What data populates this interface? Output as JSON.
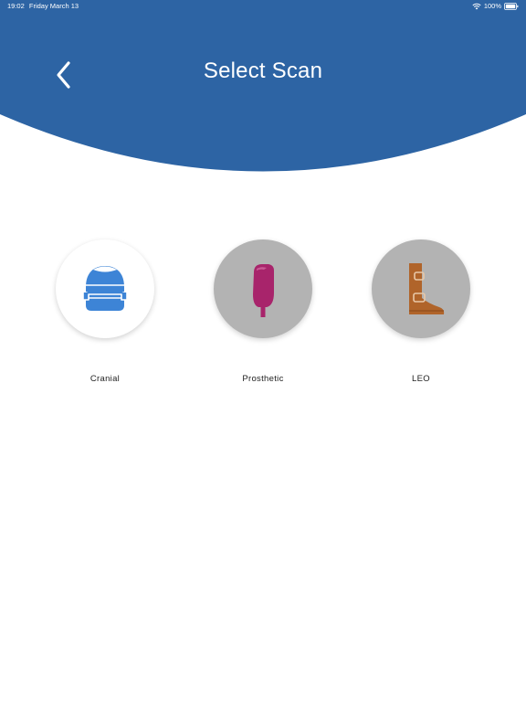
{
  "status_bar": {
    "time": "19:02",
    "date": "Friday March 13",
    "battery": "100%"
  },
  "header": {
    "title": "Select Scan",
    "back_icon": "chevron-left-icon",
    "color": "#2d64a4"
  },
  "options": [
    {
      "label": "Cranial",
      "icon": "helmet-icon",
      "selected": true,
      "circle_color": "#ffffff",
      "icon_color": "#3d84d6"
    },
    {
      "label": "Prosthetic",
      "icon": "prosthetic-leg-icon",
      "selected": false,
      "circle_color": "#b3b3b3",
      "icon_color": "#a8246b"
    },
    {
      "label": "LEO",
      "icon": "leg-brace-icon",
      "selected": false,
      "circle_color": "#b3b3b3",
      "icon_color": "#b0642a"
    }
  ]
}
